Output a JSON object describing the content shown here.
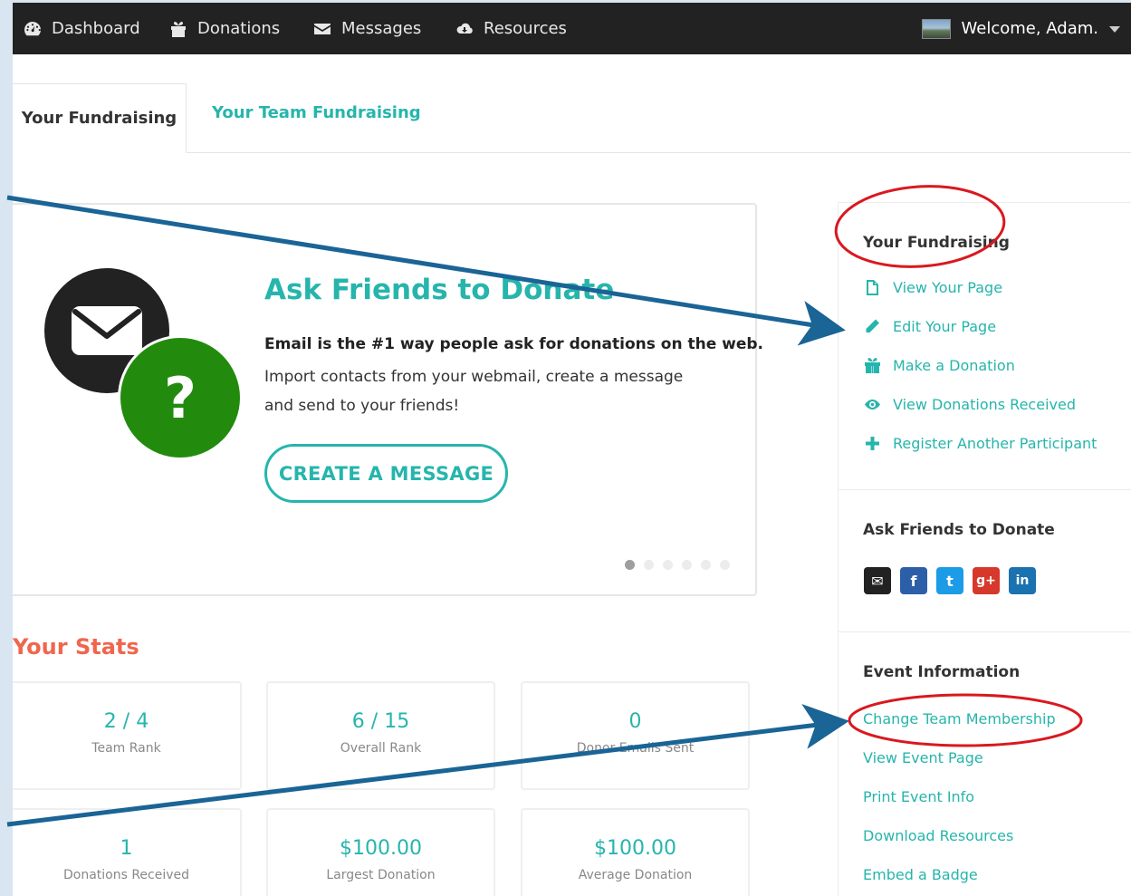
{
  "nav": {
    "items": [
      {
        "label": "Dashboard",
        "icon": "dashboard-icon"
      },
      {
        "label": "Donations",
        "icon": "gift-icon"
      },
      {
        "label": "Messages",
        "icon": "envelope-icon"
      },
      {
        "label": "Resources",
        "icon": "cloud-download-icon"
      }
    ],
    "welcome": "Welcome, Adam."
  },
  "tabs": {
    "active": "Your Fundraising",
    "other": "Your Team Fundraising"
  },
  "promo": {
    "title": "Ask Friends to Donate",
    "lead": "Email is the #1 way people ask for donations on the web.",
    "body": "Import contacts from your webmail, create a message and send to your friends!",
    "cta": "CREATE A MESSAGE",
    "question_mark": "?",
    "slides": 6,
    "active_slide": 1
  },
  "stats": {
    "title": "Your Stats",
    "items": [
      {
        "value": "2 / 4",
        "label": "Team Rank"
      },
      {
        "value": "6 / 15",
        "label": "Overall Rank"
      },
      {
        "value": "0",
        "label": "Donor Emails Sent"
      },
      {
        "value": "1",
        "label": "Donations Received"
      },
      {
        "value": "$100.00",
        "label": "Largest Donation"
      },
      {
        "value": "$100.00",
        "label": "Average Donation"
      }
    ]
  },
  "sidebar": {
    "fundraising_title": "Your Fundraising",
    "fundraising_links": [
      {
        "label": "View Your Page",
        "icon": "file-icon"
      },
      {
        "label": "Edit Your Page",
        "icon": "pencil-icon"
      },
      {
        "label": "Make a Donation",
        "icon": "gift-icon"
      },
      {
        "label": "View Donations Received",
        "icon": "eye-icon"
      },
      {
        "label": "Register Another Participant",
        "icon": "plus-icon"
      }
    ],
    "ask_title": "Ask Friends to Donate",
    "social": [
      {
        "name": "email",
        "glyph": "✉",
        "color": "#222222"
      },
      {
        "name": "facebook",
        "glyph": "f",
        "color": "#2d5fa8"
      },
      {
        "name": "twitter",
        "glyph": "t",
        "color": "#1c9be6"
      },
      {
        "name": "google-plus",
        "glyph": "g+",
        "color": "#d6392b"
      },
      {
        "name": "linkedin",
        "glyph": "in",
        "color": "#1a72b0"
      }
    ],
    "event_title": "Event Information",
    "event_links": [
      "Change Team Membership",
      "View Event Page",
      "Print Event Info",
      "Download Resources",
      "Embed a Badge"
    ]
  },
  "colors": {
    "accent": "#26b5ac",
    "stats_title": "#f0664d",
    "nav_bg": "#222222",
    "annotation_arrow": "#1a6496",
    "annotation_circle": "#d9181f"
  }
}
